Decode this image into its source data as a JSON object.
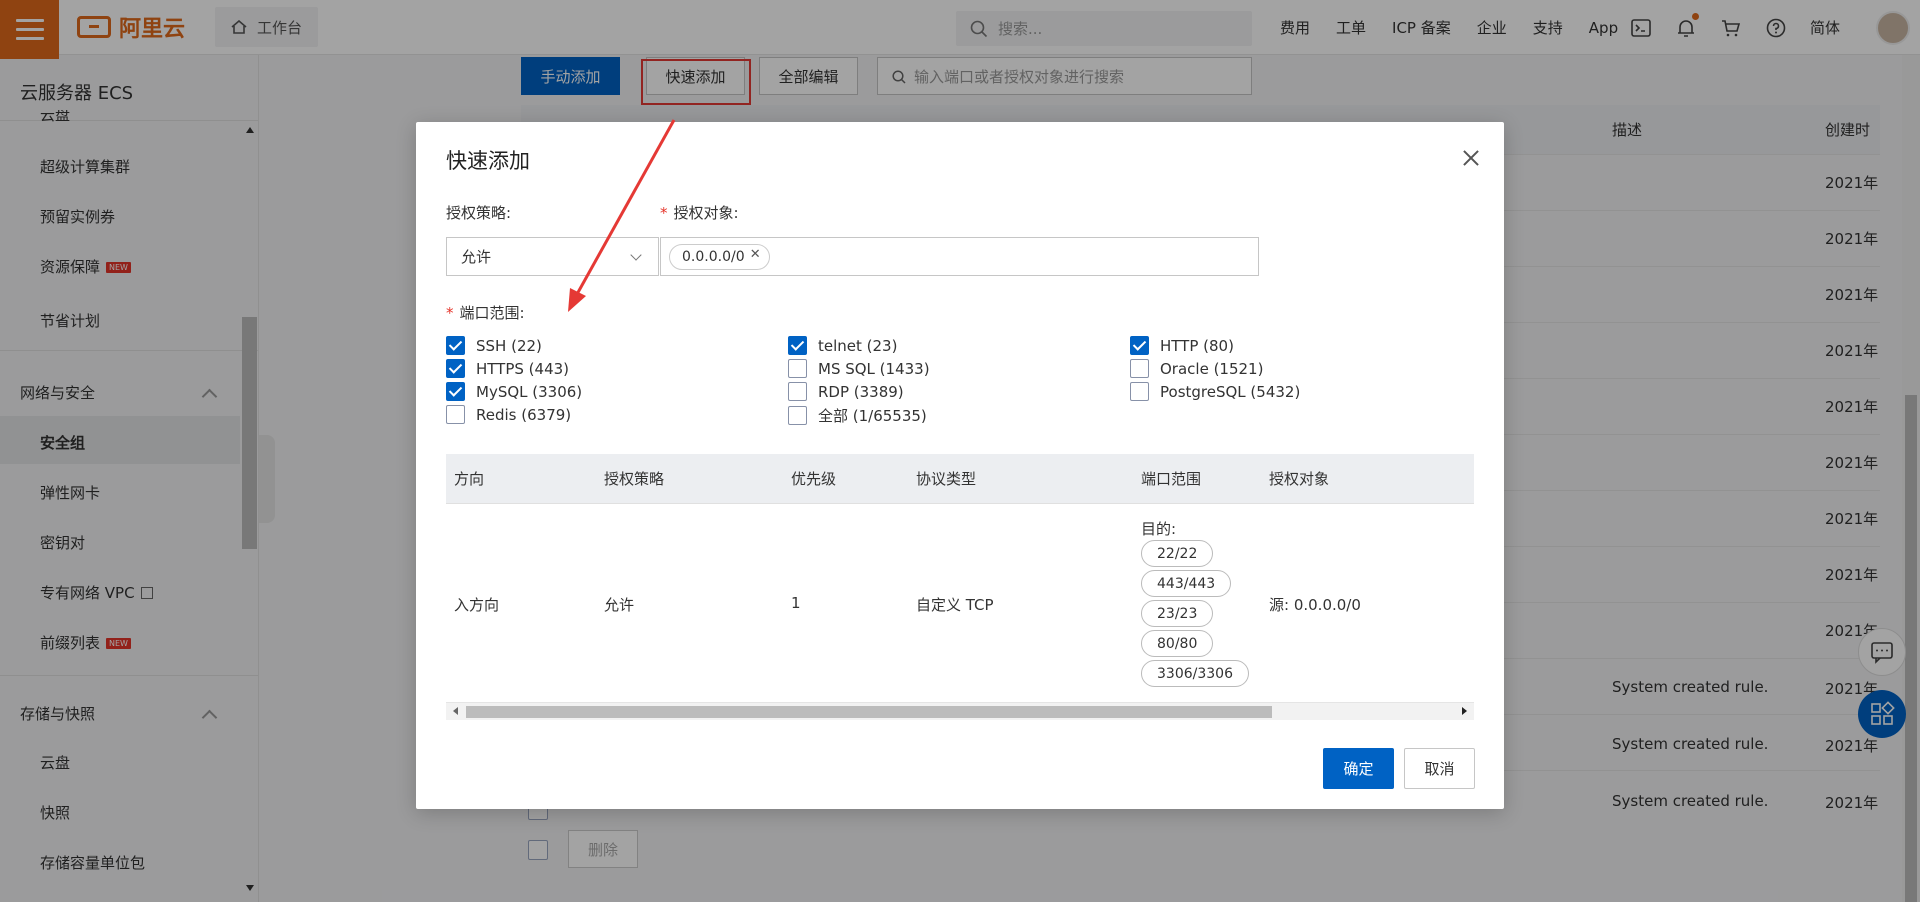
{
  "topbar": {
    "brand": "阿里云",
    "workbench": "工作台",
    "search_placeholder": "搜索...",
    "links": [
      "费用",
      "工单",
      "ICP 备案",
      "企业",
      "支持",
      "App"
    ],
    "language": "简体",
    "icons": [
      "terminal-icon",
      "bell-icon",
      "cart-icon",
      "help-icon"
    ]
  },
  "sidebar": {
    "title": "云服务器 ECS",
    "items_top": [
      "云盘",
      "超级计算集群",
      "预留实例券",
      "资源保障",
      "节省计划"
    ],
    "new_badge": "NEW",
    "group_network": "网络与安全",
    "network_items": [
      "安全组",
      "弹性网卡",
      "密钥对",
      "专有网络 VPC",
      "前缀列表"
    ],
    "group_storage": "存储与快照",
    "storage_items": [
      "云盘",
      "快照",
      "存储容量单位包"
    ]
  },
  "page": {
    "btn_manual": "手动添加",
    "btn_quick": "快速添加",
    "btn_edit_all": "全部编辑",
    "search_placeholder": "输入端口或者授权对象进行搜索",
    "col_desc": "描述",
    "col_created": "创建时",
    "year_cells": [
      "2021年",
      "2021年",
      "2021年",
      "2021年",
      "2021年",
      "2021年",
      "2021年",
      "2021年",
      "2021年",
      "2021年",
      "2021年",
      "2021年"
    ],
    "rule_desc": "System created rule.",
    "btn_delete": "删除"
  },
  "modal": {
    "title": "快速添加",
    "label_policy": "授权策略:",
    "label_object": "授权对象:",
    "policy_value": "允许",
    "object_tag": "0.0.0.0/0",
    "label_ports": "端口范围:",
    "required_mark": "*",
    "ports": [
      {
        "label": "SSH (22)",
        "checked": true
      },
      {
        "label": "telnet (23)",
        "checked": true
      },
      {
        "label": "HTTP (80)",
        "checked": true
      },
      {
        "label": "HTTPS (443)",
        "checked": true
      },
      {
        "label": "MS SQL (1433)",
        "checked": false
      },
      {
        "label": "Oracle (1521)",
        "checked": false
      },
      {
        "label": "MySQL (3306)",
        "checked": true
      },
      {
        "label": "RDP (3389)",
        "checked": false
      },
      {
        "label": "PostgreSQL (5432)",
        "checked": false
      },
      {
        "label": "Redis (6379)",
        "checked": false
      },
      {
        "label": "全部 (1/65535)",
        "checked": false
      }
    ],
    "table": {
      "headers": [
        "方向",
        "授权策略",
        "优先级",
        "协议类型",
        "端口范围",
        "授权对象"
      ],
      "row": {
        "direction": "入方向",
        "policy": "允许",
        "priority": "1",
        "protocol": "自定义 TCP",
        "port_prefix": "目的:",
        "ports": [
          "22/22",
          "443/443",
          "23/23",
          "80/80",
          "3306/3306"
        ],
        "object": "源: 0.0.0.0/0"
      }
    },
    "btn_ok": "确定",
    "btn_cancel": "取消"
  },
  "colors": {
    "brand_orange": "#e06a1b",
    "primary_blue": "#0062c4",
    "annotation_red": "#e53935"
  }
}
